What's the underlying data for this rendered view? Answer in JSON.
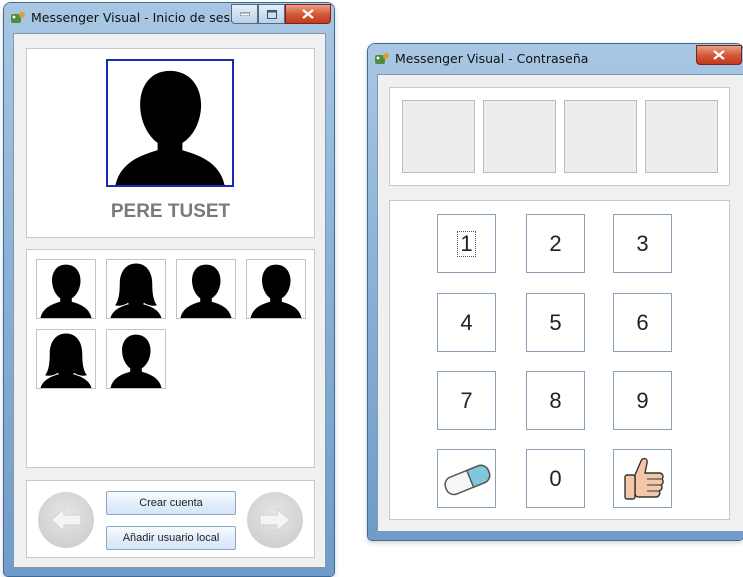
{
  "login_window": {
    "title": "Messenger Visual - Inicio de sesión",
    "selected_user_name": "PERE TUSET",
    "create_account_label": "Crear cuenta",
    "add_local_user_label": "Añadir usuario local"
  },
  "password_window": {
    "title": "Messenger Visual - Contraseña",
    "keys": [
      "1",
      "2",
      "3",
      "4",
      "5",
      "6",
      "7",
      "8",
      "9",
      "0"
    ]
  },
  "icons": {
    "app": "messenger-app-icon",
    "prev": "arrow-left-icon",
    "next": "arrow-right-icon",
    "erase": "eraser-icon",
    "accept": "thumbs-up-icon"
  },
  "colors": {
    "selected_border": "#1a2bb8",
    "name_text": "#7a7a7a",
    "titlebar": "#8eb4d8",
    "close_button": "#c0391c"
  }
}
